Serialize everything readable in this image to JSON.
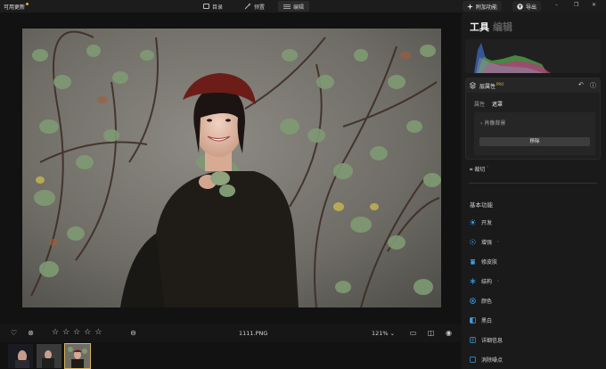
{
  "topbar": {
    "update_label": "可用更新",
    "nav": [
      {
        "label": "目录"
      },
      {
        "label": "预置"
      },
      {
        "label": "编辑"
      }
    ],
    "addon_label": "附加功能",
    "export_label": "导出"
  },
  "bottombar": {
    "filename": "1111.PNG",
    "zoom": "121%",
    "rating_stars": 5,
    "rating_value": 0
  },
  "panel": {
    "tabs": {
      "tools": "工具",
      "edit": "编辑"
    },
    "layer": {
      "title": "层属性",
      "pro_badge": "PRO",
      "subtabs": [
        "属性",
        "遮罩"
      ],
      "back_label": "肖像背景",
      "remove_label": "移除"
    },
    "crop_label": "裁切",
    "section_title": "基本功能",
    "tools": [
      {
        "label": "开发",
        "icon": "sun-icon",
        "color": "#3aa0e8"
      },
      {
        "label": "增强",
        "icon": "sparkle-icon",
        "color": "#3aa0e8"
      },
      {
        "label": "修皮肤",
        "icon": "jar-icon",
        "color": "#3aa0e8"
      },
      {
        "label": "结构",
        "icon": "snowflake-icon",
        "color": "#3aa0e8"
      },
      {
        "label": "颜色",
        "icon": "color-wheel-icon",
        "color": "#3aa0e8"
      },
      {
        "label": "黑白",
        "icon": "half-square-icon",
        "color": "#3aa0e8"
      },
      {
        "label": "详细信息",
        "icon": "details-icon",
        "color": "#3aa0e8"
      },
      {
        "label": "消除噪点",
        "icon": "denoise-icon",
        "color": "#3aa0e8"
      }
    ]
  }
}
